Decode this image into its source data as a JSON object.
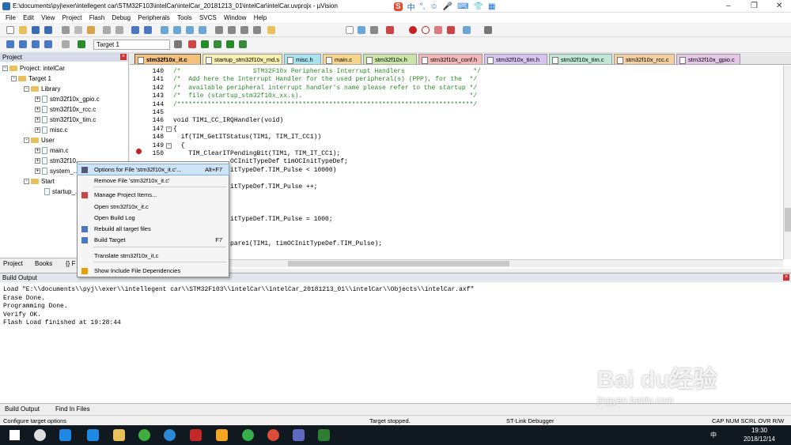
{
  "window": {
    "title": "E:\\documents\\pyj\\exer\\intellegent car\\STM32F103\\intelCar\\intelCar_20181213_01\\intelCar\\intelCar.uvprojx - µVision",
    "ime_glyphs": [
      "S",
      "中",
      "°,",
      "☺",
      "🎤",
      "⌨",
      "👕",
      "▦"
    ],
    "controls": [
      "–",
      "❐",
      "✕"
    ]
  },
  "menu": [
    "File",
    "Edit",
    "View",
    "Project",
    "Flash",
    "Debug",
    "Peripherals",
    "Tools",
    "SVCS",
    "Window",
    "Help"
  ],
  "toolbar2": {
    "target": "Target 1"
  },
  "project_panel": {
    "header": "Project",
    "tree": [
      {
        "label": "Project: intelCar"
      },
      {
        "label": "Target 1"
      },
      {
        "label": "Library"
      },
      {
        "label": "stm32f10x_gpio.c"
      },
      {
        "label": "stm32f10x_rcc.c"
      },
      {
        "label": "stm32f10x_tim.c"
      },
      {
        "label": "misc.c"
      },
      {
        "label": "User"
      },
      {
        "label": "main.c"
      },
      {
        "label": "stm32f10..."
      },
      {
        "label": "system_..."
      },
      {
        "label": "Start"
      },
      {
        "label": "startup_..."
      }
    ],
    "tabs": [
      "Project",
      "Books",
      "{} F"
    ]
  },
  "editor": {
    "tabs": [
      {
        "label": "stm32f10x_it.c",
        "color": "#f4c27a",
        "active": true
      },
      {
        "label": "startup_stm32f10x_md.s",
        "color": "#f8f0b0"
      },
      {
        "label": "misc.h",
        "color": "#a7e3f0"
      },
      {
        "label": "main.c",
        "color": "#f7d58a"
      },
      {
        "label": "stm32f10x.h",
        "color": "#c9e6a8"
      },
      {
        "label": "stm32f10x_conf.h",
        "color": "#f4b7b7"
      },
      {
        "label": "stm32f10x_tim.h",
        "color": "#d8c4f0"
      },
      {
        "label": "stm32f10x_tim.c",
        "color": "#bfe8d6"
      },
      {
        "label": "stm32f10x_rcc.c",
        "color": "#f4cfa0"
      },
      {
        "label": "stm32f10x_gpio.c",
        "color": "#e5c8e8"
      }
    ],
    "lines": [
      {
        "n": "140",
        "t": "/*                   STM32F10x Peripherals Interrupt Handlers                  */",
        "comment": true
      },
      {
        "n": "141",
        "t": "/*  Add here the Interrupt Handler for the used peripheral(s) (PPP), for the  */",
        "comment": true
      },
      {
        "n": "142",
        "t": "/*  available peripheral interrupt handler's name please refer to the startup */",
        "comment": true
      },
      {
        "n": "143",
        "t": "/*  file (startup_stm32f10x_xx.s).                                            */",
        "comment": true
      },
      {
        "n": "144",
        "t": "/******************************************************************************/",
        "comment": true
      },
      {
        "n": "145",
        "t": ""
      },
      {
        "n": "146",
        "t": "void TIM1_CC_IRQHandler(void)"
      },
      {
        "n": "147",
        "t": "{"
      },
      {
        "n": "148",
        "t": "  if(TIM_GetITStatus(TIM1, TIM_IT_CC1))"
      },
      {
        "n": "149",
        "t": "  {"
      },
      {
        "n": "150",
        "t": "    TIM_ClearITPendingBit(TIM1, TIM_IT_CC1);"
      },
      {
        "n": "",
        "t": "               OCInitTypeDef timOCInitTypeDef;"
      },
      {
        "n": "",
        "t": "               itTypeDef.TIM_Pulse < 10000)"
      },
      {
        "n": "",
        "t": ""
      },
      {
        "n": "",
        "t": "               itTypeDef.TIM_Pulse ++;"
      },
      {
        "n": "",
        "t": ""
      },
      {
        "n": "",
        "t": ""
      },
      {
        "n": "",
        "t": ""
      },
      {
        "n": "",
        "t": "               itTypeDef.TIM_Pulse = 1000;"
      },
      {
        "n": "",
        "t": ""
      },
      {
        "n": "",
        "t": ""
      },
      {
        "n": "",
        "t": "               pare1(TIM1, timOCInitTypeDef.TIM_Pulse);"
      }
    ]
  },
  "context_menu": {
    "items": [
      {
        "label": "Options for File 'stm32f10x_it.c'...",
        "shortcut": "Alt+F7",
        "highlight": true,
        "icon": "wrench-icon"
      },
      {
        "label": "Remove File 'stm32f10x_it.c'",
        "shortcut": ""
      },
      {
        "label": "Manage Project Items...",
        "shortcut": "",
        "icon": "manage-items-icon"
      },
      {
        "label": "Open stm32f10x_it.c",
        "shortcut": ""
      },
      {
        "label": "Open Build Log",
        "shortcut": ""
      },
      {
        "label": "Rebuild all target files",
        "shortcut": "",
        "icon": "rebuild-icon"
      },
      {
        "label": "Build Target",
        "shortcut": "F7",
        "icon": "build-icon"
      },
      {
        "label": "Translate stm32f10x_it.c",
        "shortcut": ""
      },
      {
        "label": "Show Include File Dependencies",
        "shortcut": "",
        "icon": "checkmark-icon"
      }
    ]
  },
  "build_output": {
    "header": "Build Output",
    "lines": [
      "Load \"E:\\\\documents\\\\pyj\\\\exer\\\\intellegent car\\\\STM32F103\\\\intelCar\\\\intelCar_20181213_01\\\\intelCar\\\\Objects\\\\intelCar.axf\"",
      "Erase Done.",
      "Programming Done.",
      "Verify OK.",
      "Flash Load finished at 19:28:44"
    ],
    "tabs": [
      "Build Output",
      "Find In Files"
    ]
  },
  "status": {
    "left": "Configure target options",
    "mid": "Target stopped.",
    "debugger": "ST-Link Debugger",
    "flags": "CAP  NUM  SCRL  OVR  R/W"
  },
  "taskbar": {
    "time": "19:30",
    "date": "2018/12/14",
    "lang": "中"
  },
  "watermark": {
    "text": "Bai du经验",
    "sub": "jingyan.baidu.com"
  },
  "colors": {
    "accent": "#cde3f7",
    "breakpoint": "#c81e1e",
    "comment": "#2a8a2a"
  }
}
